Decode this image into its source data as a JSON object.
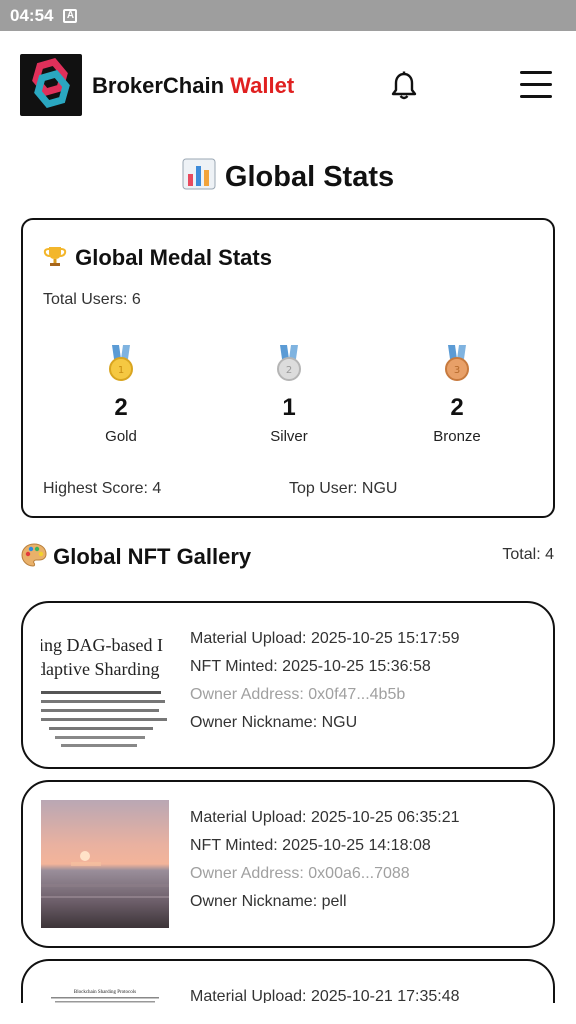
{
  "status": {
    "time": "04:54",
    "indicator": "A"
  },
  "brand": {
    "name": "BrokerChain",
    "accent": "Wallet"
  },
  "page": {
    "title": "Global Stats"
  },
  "medal_stats": {
    "title": "Global Medal Stats",
    "total_users": "Total Users: 6",
    "medals": [
      {
        "count": "2",
        "label": "Gold"
      },
      {
        "count": "1",
        "label": "Silver"
      },
      {
        "count": "2",
        "label": "Bronze"
      }
    ],
    "highest_score": "Highest Score: 4",
    "top_user": "Top User: NGU"
  },
  "gallery": {
    "title": "Global NFT Gallery",
    "total": "Total: 4",
    "items": [
      {
        "upload": "Material Upload: 2025-10-25 15:17:59",
        "minted": "NFT Minted: 2025-10-25 15:36:58",
        "owner_address": "Owner Address: 0x0f47...4b5b",
        "nickname": "Owner Nickname: NGU",
        "thumb_lines": [
          "ing DAG-based I",
          "daptive Sharding"
        ]
      },
      {
        "upload": "Material Upload: 2025-10-25 06:35:21",
        "minted": "NFT Minted: 2025-10-25 14:18:08",
        "owner_address": "Owner Address: 0x00a6...7088",
        "nickname": "Owner Nickname: pell"
      },
      {
        "upload": "Material Upload: 2025-10-21 17:35:48",
        "thumb_lines": [
          "Blockchain Sharding Protocols"
        ]
      }
    ]
  },
  "colors": {
    "accent": "#e02020",
    "border": "#111111",
    "status_bar": "#9e9e9e"
  }
}
